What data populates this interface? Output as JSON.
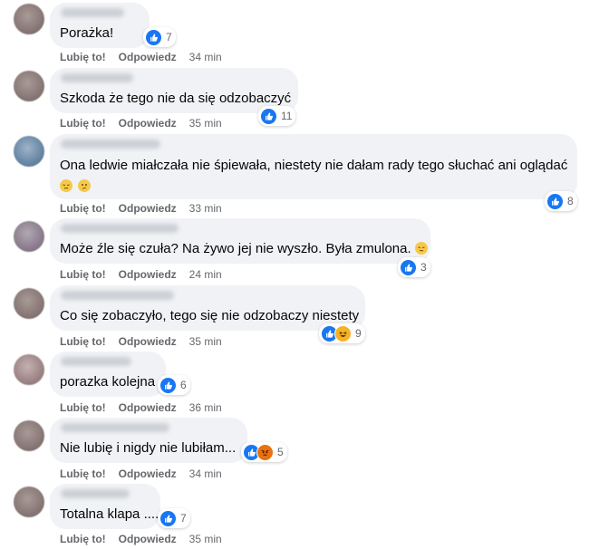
{
  "actions": {
    "like": "Lubię to!",
    "reply": "Odpowiedz"
  },
  "comments": [
    {
      "text": "Porażka!",
      "reactions": [
        "like"
      ],
      "count": "7",
      "time": "34 min"
    },
    {
      "text": "Szkoda że tego nie da się odzobaczyć",
      "reactions": [
        "like"
      ],
      "count": "11",
      "time": "35 min"
    },
    {
      "text": "Ona ledwie miałczała nie śpiewała, niestety nie dałam rady tego słuchać ani oglądać",
      "emojis": [
        "pensive-emoji",
        "confused-emoji"
      ],
      "reactions": [
        "like"
      ],
      "count": "8",
      "time": "33 min"
    },
    {
      "text": "Może źle się czuła? Na żywo jej nie wyszło. Była zmulona.",
      "emojis": [
        "pensive-emoji"
      ],
      "reactions": [
        "like"
      ],
      "count": "3",
      "time": "24 min"
    },
    {
      "text": "Co się zobaczyło, tego się nie odzobaczy niestety",
      "reactions": [
        "like",
        "haha"
      ],
      "count": "9",
      "time": "35 min"
    },
    {
      "text": "porazka kolejna",
      "reactions": [
        "like"
      ],
      "count": "6",
      "time": "36 min"
    },
    {
      "text": "Nie lubię i nigdy nie lubiłam...",
      "reactions": [
        "like",
        "angry"
      ],
      "count": "5",
      "time": "34 min"
    },
    {
      "text": "Totalna klapa ....",
      "reactions": [
        "like"
      ],
      "count": "7",
      "time": "35 min"
    }
  ]
}
